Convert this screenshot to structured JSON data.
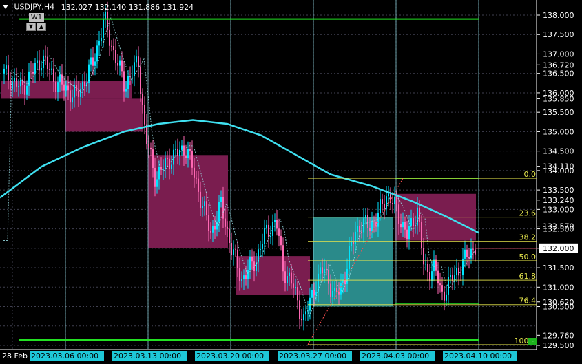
{
  "header": {
    "symbol": "USDJPY,H4",
    "ohlc": "132.027 132.140 131.886 131.924"
  },
  "timeframe": {
    "label": "W1",
    "down_arrow": "▼",
    "up_arrow": "▲"
  },
  "chart_data": {
    "type": "candlestick",
    "symbol": "USDJPY",
    "timeframe": "H4",
    "ylim": [
      129.5,
      138.0
    ],
    "price_labels": [
      "138.000",
      "137.500",
      "137.000",
      "136.720",
      "136.500",
      "136.000",
      "135.850",
      "135.500",
      "135.000",
      "134.500",
      "134.110",
      "134.000",
      "133.500",
      "133.240",
      "133.000",
      "132.570",
      "132.500",
      "132.000",
      "131.500",
      "131.000",
      "130.620",
      "130.500",
      "129.760",
      "129.500"
    ],
    "current_price": "132.000",
    "time_labels": [
      "28 Feb",
      "2023.03.06 00:00",
      "2023.03.13 00:00",
      "2023.03.20 00:00",
      "2023.03.27 00:00",
      "2023.04.03 00:00",
      "2023.04.10 00:00"
    ],
    "fib_levels": [
      {
        "label": "0.0",
        "price": 133.8
      },
      {
        "label": "23.6",
        "price": 132.8
      },
      {
        "label": "38.2",
        "price": 132.18
      },
      {
        "label": "50.0",
        "price": 131.68
      },
      {
        "label": "61.8",
        "price": 131.18
      },
      {
        "label": "76.4",
        "price": 130.55
      },
      {
        "label": "100.0",
        "price": 129.52
      }
    ],
    "horizontal_lines": [
      137.9,
      129.5
    ],
    "colors": {
      "background": "#000000",
      "bull": "#00e5ff",
      "bear": "#ff69b4",
      "ma": "#3fe0f0",
      "fib": "#e6e64d",
      "level": "#22e022",
      "supply_zone": "#7a1d4f",
      "demand_zone": "#2a8a8a",
      "grid": "#404050"
    }
  },
  "corner_button": "-"
}
